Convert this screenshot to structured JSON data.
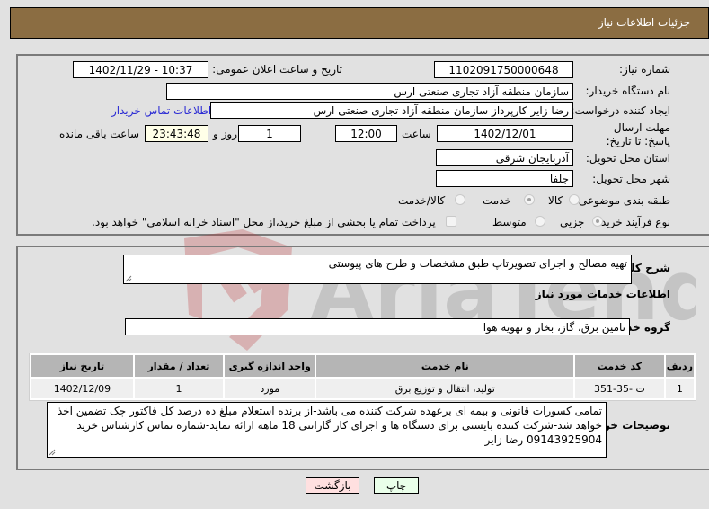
{
  "header": {
    "title": "جزئیات اطلاعات نیاز"
  },
  "fields": {
    "need_number_label": "شماره نیاز:",
    "need_number": "1102091750000648",
    "announce_label": "تاریخ و ساعت اعلان عمومی:",
    "announce_value": "1402/11/29 - 10:37",
    "buyer_org_label": "نام دستگاه خریدار:",
    "buyer_org": "سازمان منطقه آزاد تجاری صنعتی ارس",
    "creator_label": "ایجاد کننده درخواست:",
    "creator": "رضا زایر کارپرداز سازمان منطقه آزاد تجاری صنعتی ارس",
    "contact_link": "اطلاعات تماس خریدار",
    "deadline_label": "مهلت ارسال پاسخ: تا تاریخ:",
    "deadline_date": "1402/12/01",
    "time_label": "ساعت",
    "deadline_time": "12:00",
    "days": "1",
    "days_label": "روز و",
    "remaining": "23:43:48",
    "remaining_label": "ساعت باقی مانده",
    "province_label": "استان محل تحویل:",
    "province": "آذربایجان شرقی",
    "city_label": "شهر محل تحویل:",
    "city": "جلفا",
    "category_label": "طبقه بندی موضوعی:",
    "category_options": [
      {
        "label": "کالا",
        "checked": false
      },
      {
        "label": "خدمت",
        "checked": true
      },
      {
        "label": "کالا/خدمت",
        "checked": false
      }
    ],
    "process_label": "نوع فرآیند خرید :",
    "process_options": [
      {
        "label": "جزیی",
        "checked": true
      },
      {
        "label": "متوسط",
        "checked": false
      }
    ],
    "treasury_note": "پرداخت تمام یا بخشی از مبلغ خرید،از محل \"اسناد خزانه اسلامی\" خواهد بود."
  },
  "description": {
    "label": "شرح کلی نیاز:",
    "value": "تهیه مصالح و اجرای تصویرتاپ طبق مشخصات و طرح های پیوستی"
  },
  "services": {
    "section_title": "اطلاعات خدمات مورد نیاز",
    "group_label": "گروه خدمت:",
    "group_value": "تامین برق، گاز، بخار و تهویه هوا",
    "table": {
      "headers": [
        "ردیف",
        "کد خدمت",
        "نام خدمت",
        "واحد اندازه گیری",
        "تعداد / مقدار",
        "تاریخ نیاز"
      ],
      "rows": [
        [
          "1",
          "ت -35-351",
          "تولید، انتقال و توزیع برق",
          "مورد",
          "1",
          "1402/12/09"
        ]
      ]
    }
  },
  "buyer_notes": {
    "label": "توضیحات خریدار:",
    "value": "تمامی کسورات قانونی و بیمه ای برعهده شرکت کننده می باشد-از برنده استعلام مبلغ ده درصد کل فاکتور چک تضمین اخذ خواهد شد-شرکت کننده بایستی برای دستگاه ها و اجرای کار گارانتی 18 ماهه ارائه نماید-شماره تماس کارشناس خرید 09143925904 رضا زایر"
  },
  "buttons": {
    "print": "چاپ",
    "back": "بازگشت"
  },
  "watermark": {
    "text": "AriaTender.net"
  },
  "colors": {
    "header_bg": "#8b6d42",
    "print_bg": "#eaffea",
    "back_bg": "#ffe0e0",
    "link": "#2b2bd4"
  }
}
